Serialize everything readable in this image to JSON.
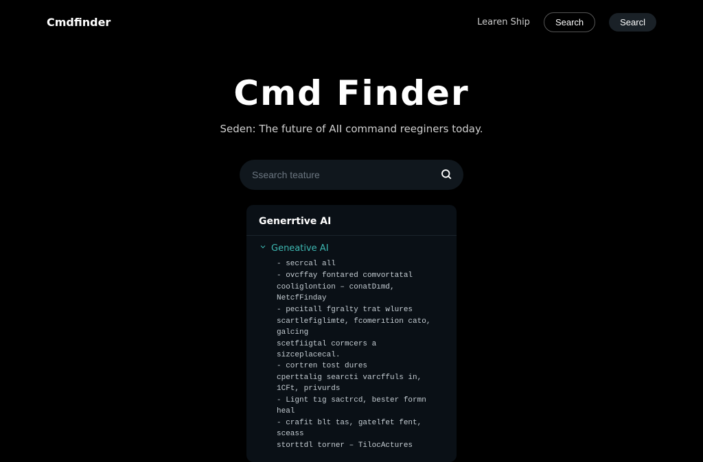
{
  "header": {
    "logo": "Cmdfinder",
    "link": "Learen Ship",
    "btn1": "Search",
    "btn2": "Searcl"
  },
  "hero": {
    "title": "Cmd Finder",
    "subtitle": "Seden: The future of AII command reeginers today."
  },
  "search": {
    "placeholder": "Ssearch teature"
  },
  "card": {
    "title": "Generrtive AI",
    "tree_label": "Geneative AI",
    "lines": [
      "- secrcal all",
      "- ovcffay fontared comvortatal",
      "  cooliglontion – conatDımd, NetcfFinday",
      "- pecitall fgralty trat wlures",
      "scartlefiglimte, fcomerıtion cato, galcing",
      "scetfiigtal cormcers a sizceplacecal.",
      "- cortren tost dures",
      "cperttalig searcti varcffuls in, 1CFt, privurds",
      "- Lignt tıg sactrcd, bester formn heal",
      "- crafit blt tas, gatelfet fent, sceass",
      "storttdl torner – TilocActures"
    ]
  }
}
